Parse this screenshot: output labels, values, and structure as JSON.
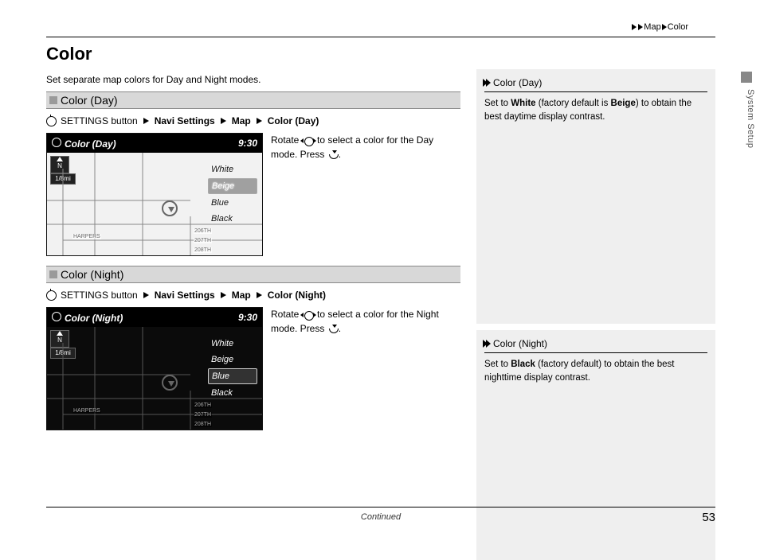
{
  "breadcrumb": {
    "a": "Map",
    "b": "Color"
  },
  "side_label": "System Setup",
  "title": "Color",
  "intro": "Set separate map colors for Day and Night modes.",
  "continued": "Continued",
  "page_number": "53",
  "day": {
    "heading": "Color (Day)",
    "crumb": {
      "settings": "SETTINGS button",
      "navi": "Navi Settings",
      "map": "Map",
      "final": "Color (Day)"
    },
    "screen": {
      "title": "Color (Day)",
      "time": "9:30",
      "compass": "N",
      "scale": "1/8mi",
      "labels": {
        "harpers": "HARPERS",
        "r1": "206TH",
        "r2": "207TH",
        "r3": "208TH"
      },
      "options": [
        "White",
        "Beige",
        "Blue",
        "Black"
      ],
      "selected": 1
    },
    "instr": {
      "p1": "Rotate",
      "p2": "to select a color for the Day mode. Press",
      "p3": "."
    },
    "tip": {
      "hdr": "Color (Day)",
      "pre": "Set to ",
      "bold1": "White",
      "mid": " (factory default is ",
      "bold2": "Beige",
      "post": ") to obtain the best daytime display contrast."
    }
  },
  "night": {
    "heading": "Color (Night)",
    "crumb": {
      "settings": "SETTINGS button",
      "navi": "Navi Settings",
      "map": "Map",
      "final": "Color (Night)"
    },
    "screen": {
      "title": "Color (Night)",
      "time": "9:30",
      "compass": "N",
      "scale": "1/8mi",
      "labels": {
        "harpers": "HARPERS",
        "r1": "206TH",
        "r2": "207TH",
        "r3": "208TH"
      },
      "options": [
        "White",
        "Beige",
        "Blue",
        "Black"
      ],
      "selected": 2
    },
    "instr": {
      "p1": "Rotate",
      "p2": "to select a color for the Night mode. Press",
      "p3": "."
    },
    "tip": {
      "hdr": "Color (Night)",
      "pre": "Set to ",
      "bold1": "Black",
      "post": " (factory default) to obtain the best nighttime display contrast."
    }
  }
}
